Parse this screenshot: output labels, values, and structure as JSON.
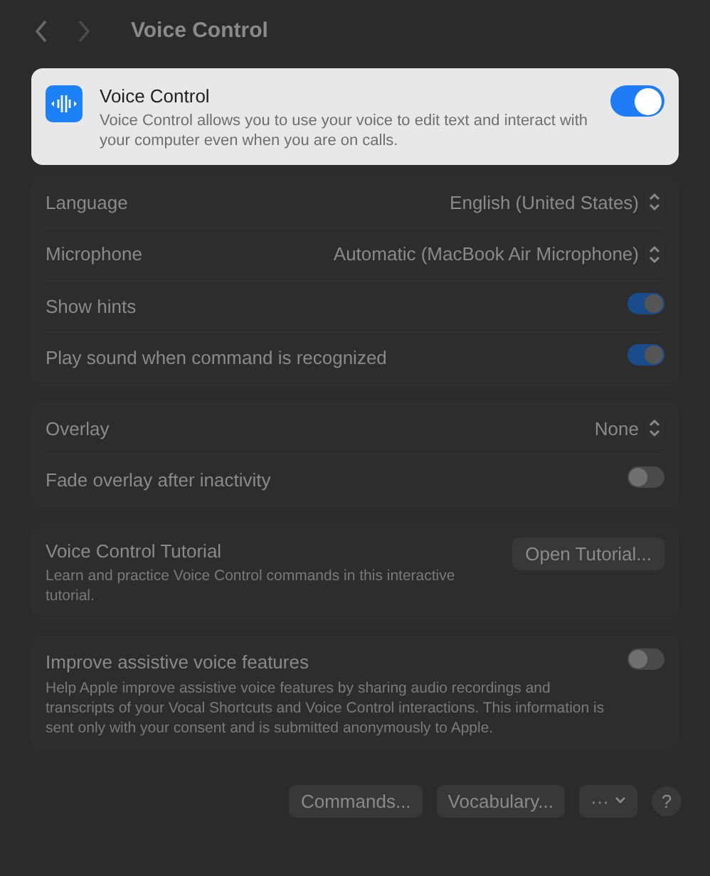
{
  "header": {
    "title": "Voice Control"
  },
  "feature": {
    "title": "Voice Control",
    "description": "Voice Control allows you to use your voice to edit text and interact with your computer even when you are on calls.",
    "on": true
  },
  "groups": [
    {
      "rows": [
        {
          "kind": "popup",
          "label": "Language",
          "value": "English (United States)"
        },
        {
          "kind": "popup",
          "label": "Microphone",
          "value": "Automatic (MacBook Air Microphone)"
        },
        {
          "kind": "toggle",
          "label": "Show hints",
          "on": true
        },
        {
          "kind": "toggle",
          "label": "Play sound when command is recognized",
          "on": true
        }
      ]
    },
    {
      "rows": [
        {
          "kind": "popup",
          "label": "Overlay",
          "value": "None"
        },
        {
          "kind": "toggle",
          "label": "Fade overlay after inactivity",
          "on": false
        }
      ]
    },
    {
      "rows": [
        {
          "kind": "button",
          "label": "Voice Control Tutorial",
          "description": "Learn and practice Voice Control commands in this interactive tutorial.",
          "button": "Open Tutorial..."
        }
      ]
    },
    {
      "rows": [
        {
          "kind": "toggle",
          "label": "Improve assistive voice features",
          "description": "Help Apple improve assistive voice features by sharing audio recordings and transcripts of your Vocal Shortcuts and Voice Control interactions. This information is sent only with your consent and is submitted anonymously to Apple.",
          "on": false
        }
      ]
    }
  ],
  "footer": {
    "buttons": [
      "Commands...",
      "Vocabulary..."
    ],
    "more": "···",
    "help": "?"
  }
}
